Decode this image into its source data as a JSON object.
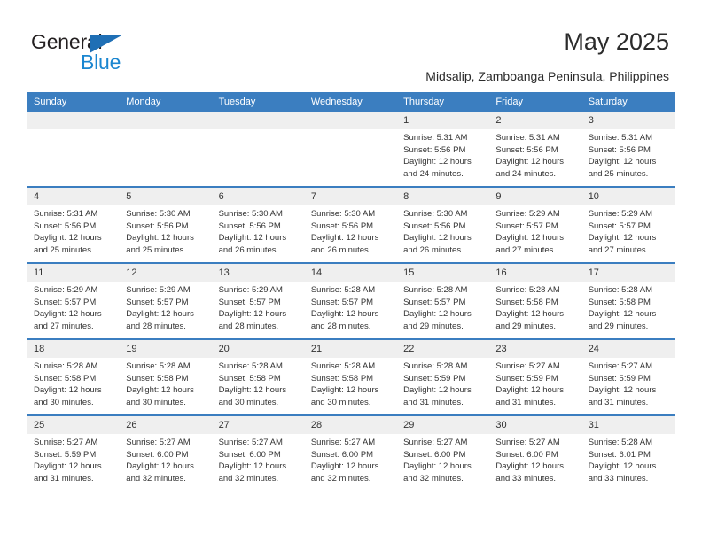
{
  "brand": {
    "name_top": "General",
    "name_bottom": "Blue",
    "triangle_color": "#1f6fb5",
    "blue_text_color": "#1a86d0"
  },
  "header": {
    "title": "May 2025",
    "subtitle": "Midsalip, Zamboanga Peninsula, Philippines"
  },
  "theme": {
    "header_row_bg": "#3b7ec0",
    "header_row_text": "#ffffff",
    "daynum_bg": "#efefef",
    "body_text": "#333333"
  },
  "weekday_headers": [
    "Sunday",
    "Monday",
    "Tuesday",
    "Wednesday",
    "Thursday",
    "Friday",
    "Saturday"
  ],
  "labels": {
    "sunrise_prefix": "Sunrise:",
    "sunset_prefix": "Sunset:",
    "daylight_prefix": "Daylight:"
  },
  "weeks": [
    [
      {
        "day": "",
        "empty": true
      },
      {
        "day": "",
        "empty": true
      },
      {
        "day": "",
        "empty": true
      },
      {
        "day": "",
        "empty": true
      },
      {
        "day": "1",
        "sunrise": "Sunrise: 5:31 AM",
        "sunset": "Sunset: 5:56 PM",
        "daylight_1": "Daylight: 12 hours",
        "daylight_2": "and 24 minutes."
      },
      {
        "day": "2",
        "sunrise": "Sunrise: 5:31 AM",
        "sunset": "Sunset: 5:56 PM",
        "daylight_1": "Daylight: 12 hours",
        "daylight_2": "and 24 minutes."
      },
      {
        "day": "3",
        "sunrise": "Sunrise: 5:31 AM",
        "sunset": "Sunset: 5:56 PM",
        "daylight_1": "Daylight: 12 hours",
        "daylight_2": "and 25 minutes."
      }
    ],
    [
      {
        "day": "4",
        "sunrise": "Sunrise: 5:31 AM",
        "sunset": "Sunset: 5:56 PM",
        "daylight_1": "Daylight: 12 hours",
        "daylight_2": "and 25 minutes."
      },
      {
        "day": "5",
        "sunrise": "Sunrise: 5:30 AM",
        "sunset": "Sunset: 5:56 PM",
        "daylight_1": "Daylight: 12 hours",
        "daylight_2": "and 25 minutes."
      },
      {
        "day": "6",
        "sunrise": "Sunrise: 5:30 AM",
        "sunset": "Sunset: 5:56 PM",
        "daylight_1": "Daylight: 12 hours",
        "daylight_2": "and 26 minutes."
      },
      {
        "day": "7",
        "sunrise": "Sunrise: 5:30 AM",
        "sunset": "Sunset: 5:56 PM",
        "daylight_1": "Daylight: 12 hours",
        "daylight_2": "and 26 minutes."
      },
      {
        "day": "8",
        "sunrise": "Sunrise: 5:30 AM",
        "sunset": "Sunset: 5:56 PM",
        "daylight_1": "Daylight: 12 hours",
        "daylight_2": "and 26 minutes."
      },
      {
        "day": "9",
        "sunrise": "Sunrise: 5:29 AM",
        "sunset": "Sunset: 5:57 PM",
        "daylight_1": "Daylight: 12 hours",
        "daylight_2": "and 27 minutes."
      },
      {
        "day": "10",
        "sunrise": "Sunrise: 5:29 AM",
        "sunset": "Sunset: 5:57 PM",
        "daylight_1": "Daylight: 12 hours",
        "daylight_2": "and 27 minutes."
      }
    ],
    [
      {
        "day": "11",
        "sunrise": "Sunrise: 5:29 AM",
        "sunset": "Sunset: 5:57 PM",
        "daylight_1": "Daylight: 12 hours",
        "daylight_2": "and 27 minutes."
      },
      {
        "day": "12",
        "sunrise": "Sunrise: 5:29 AM",
        "sunset": "Sunset: 5:57 PM",
        "daylight_1": "Daylight: 12 hours",
        "daylight_2": "and 28 minutes."
      },
      {
        "day": "13",
        "sunrise": "Sunrise: 5:29 AM",
        "sunset": "Sunset: 5:57 PM",
        "daylight_1": "Daylight: 12 hours",
        "daylight_2": "and 28 minutes."
      },
      {
        "day": "14",
        "sunrise": "Sunrise: 5:28 AM",
        "sunset": "Sunset: 5:57 PM",
        "daylight_1": "Daylight: 12 hours",
        "daylight_2": "and 28 minutes."
      },
      {
        "day": "15",
        "sunrise": "Sunrise: 5:28 AM",
        "sunset": "Sunset: 5:57 PM",
        "daylight_1": "Daylight: 12 hours",
        "daylight_2": "and 29 minutes."
      },
      {
        "day": "16",
        "sunrise": "Sunrise: 5:28 AM",
        "sunset": "Sunset: 5:58 PM",
        "daylight_1": "Daylight: 12 hours",
        "daylight_2": "and 29 minutes."
      },
      {
        "day": "17",
        "sunrise": "Sunrise: 5:28 AM",
        "sunset": "Sunset: 5:58 PM",
        "daylight_1": "Daylight: 12 hours",
        "daylight_2": "and 29 minutes."
      }
    ],
    [
      {
        "day": "18",
        "sunrise": "Sunrise: 5:28 AM",
        "sunset": "Sunset: 5:58 PM",
        "daylight_1": "Daylight: 12 hours",
        "daylight_2": "and 30 minutes."
      },
      {
        "day": "19",
        "sunrise": "Sunrise: 5:28 AM",
        "sunset": "Sunset: 5:58 PM",
        "daylight_1": "Daylight: 12 hours",
        "daylight_2": "and 30 minutes."
      },
      {
        "day": "20",
        "sunrise": "Sunrise: 5:28 AM",
        "sunset": "Sunset: 5:58 PM",
        "daylight_1": "Daylight: 12 hours",
        "daylight_2": "and 30 minutes."
      },
      {
        "day": "21",
        "sunrise": "Sunrise: 5:28 AM",
        "sunset": "Sunset: 5:58 PM",
        "daylight_1": "Daylight: 12 hours",
        "daylight_2": "and 30 minutes."
      },
      {
        "day": "22",
        "sunrise": "Sunrise: 5:28 AM",
        "sunset": "Sunset: 5:59 PM",
        "daylight_1": "Daylight: 12 hours",
        "daylight_2": "and 31 minutes."
      },
      {
        "day": "23",
        "sunrise": "Sunrise: 5:27 AM",
        "sunset": "Sunset: 5:59 PM",
        "daylight_1": "Daylight: 12 hours",
        "daylight_2": "and 31 minutes."
      },
      {
        "day": "24",
        "sunrise": "Sunrise: 5:27 AM",
        "sunset": "Sunset: 5:59 PM",
        "daylight_1": "Daylight: 12 hours",
        "daylight_2": "and 31 minutes."
      }
    ],
    [
      {
        "day": "25",
        "sunrise": "Sunrise: 5:27 AM",
        "sunset": "Sunset: 5:59 PM",
        "daylight_1": "Daylight: 12 hours",
        "daylight_2": "and 31 minutes."
      },
      {
        "day": "26",
        "sunrise": "Sunrise: 5:27 AM",
        "sunset": "Sunset: 6:00 PM",
        "daylight_1": "Daylight: 12 hours",
        "daylight_2": "and 32 minutes."
      },
      {
        "day": "27",
        "sunrise": "Sunrise: 5:27 AM",
        "sunset": "Sunset: 6:00 PM",
        "daylight_1": "Daylight: 12 hours",
        "daylight_2": "and 32 minutes."
      },
      {
        "day": "28",
        "sunrise": "Sunrise: 5:27 AM",
        "sunset": "Sunset: 6:00 PM",
        "daylight_1": "Daylight: 12 hours",
        "daylight_2": "and 32 minutes."
      },
      {
        "day": "29",
        "sunrise": "Sunrise: 5:27 AM",
        "sunset": "Sunset: 6:00 PM",
        "daylight_1": "Daylight: 12 hours",
        "daylight_2": "and 32 minutes."
      },
      {
        "day": "30",
        "sunrise": "Sunrise: 5:27 AM",
        "sunset": "Sunset: 6:00 PM",
        "daylight_1": "Daylight: 12 hours",
        "daylight_2": "and 33 minutes."
      },
      {
        "day": "31",
        "sunrise": "Sunrise: 5:28 AM",
        "sunset": "Sunset: 6:01 PM",
        "daylight_1": "Daylight: 12 hours",
        "daylight_2": "and 33 minutes."
      }
    ]
  ]
}
